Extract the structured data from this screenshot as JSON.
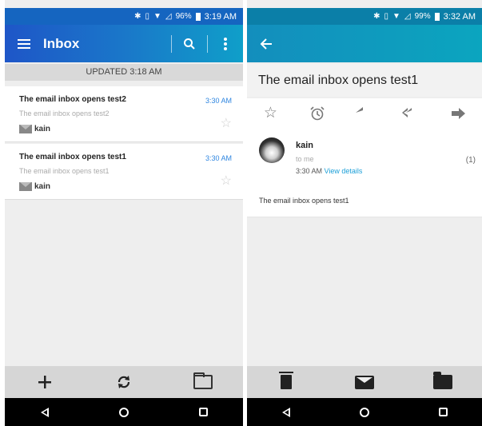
{
  "left": {
    "status": {
      "icons": [
        "bluetooth-icon",
        "vibrate-icon",
        "wifi-icon",
        "signal-icon"
      ],
      "battery": "96%",
      "time": "3:19 AM"
    },
    "appbar": {
      "title": "Inbox"
    },
    "updated": "UPDATED 3:18 AM",
    "emails": [
      {
        "subject": "The email inbox opens test2",
        "snippet": "The email inbox opens test2",
        "time": "3:30 AM",
        "label": "kain"
      },
      {
        "subject": "The email inbox opens test1",
        "snippet": "The email inbox opens test1",
        "time": "3:30 AM",
        "label": "kain"
      }
    ],
    "bottom": [
      "add-icon",
      "sync-icon",
      "folder-icon"
    ]
  },
  "right": {
    "status": {
      "battery": "99%",
      "time": "3:32 AM"
    },
    "subject": "The email inbox opens test1",
    "sender": {
      "name": "kain",
      "to": "to me",
      "time": "3:30 AM",
      "view_details": "View details",
      "count": "(1)"
    },
    "body": "The email inbox opens test1",
    "bottom": [
      "delete-icon",
      "mail-icon",
      "folder-icon"
    ]
  },
  "colors": {
    "appbar_left": "#1a77c9",
    "appbar_right": "#0ba5bf",
    "link": "#1ea0d8"
  }
}
